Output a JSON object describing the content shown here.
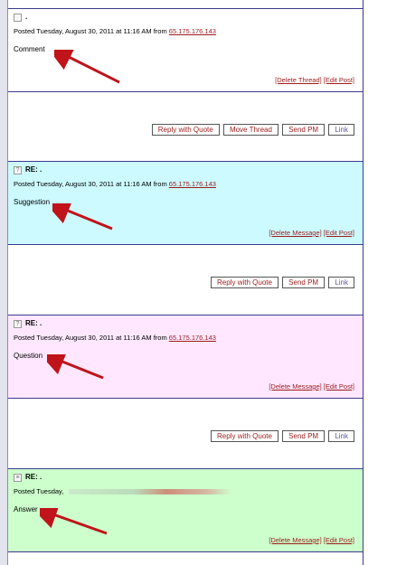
{
  "posts": [
    {
      "title": ".",
      "meta_prefix": "Posted Tuesday, August 30, 2011 at 11:16 AM from",
      "ip": "65.175.176.143",
      "body": "Comment",
      "links": [
        "[Delete Thread]",
        "[Edit Post]"
      ],
      "buttons": [
        "Reply with Quote",
        "Move Thread",
        "Send PM",
        "Link"
      ],
      "background": "#ffffff"
    },
    {
      "title": "RE: .",
      "meta_prefix": "Posted Tuesday, August 30, 2011 at 11:16 AM from",
      "ip": "65.175.176.143",
      "body": "Suggestion",
      "links": [
        "[Delete Message]",
        "[Edit Post]"
      ],
      "buttons": [
        "Reply with Quote",
        "Send PM",
        "Link"
      ],
      "background": "#ccfaff"
    },
    {
      "title": "RE: .",
      "meta_prefix": "Posted Tuesday, August 30, 2011 at 11:16 AM from",
      "ip": "65.175.176.143",
      "body": "Question",
      "links": [
        "[Delete Message]",
        "[Edit Post]"
      ],
      "buttons": [
        "Reply with Quote",
        "Send PM",
        "Link"
      ],
      "background": "#ffe8ff"
    },
    {
      "title": "RE: .",
      "meta_prefix": "Posted Tuesday,",
      "body": "Answer",
      "links": [
        "[Delete Message]",
        "[Edit Post]"
      ],
      "background": "#ccffcc"
    }
  ],
  "colors": {
    "border": "#3b3b8f",
    "link": "#9b1c1c",
    "arrow": "#c0131a"
  }
}
